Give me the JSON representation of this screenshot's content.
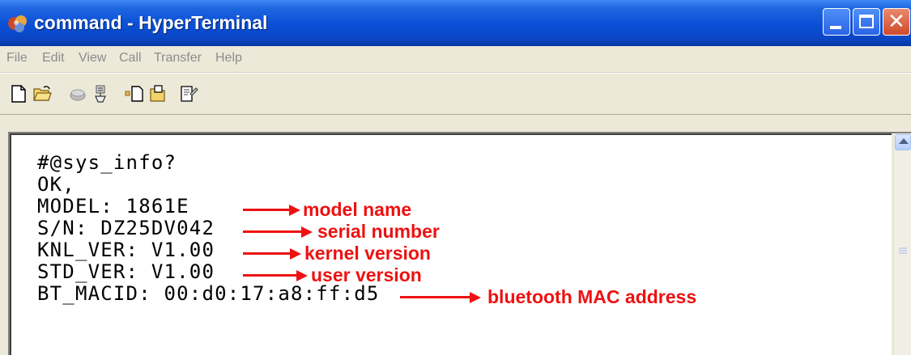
{
  "window": {
    "title": "command - HyperTerminal",
    "controls": {
      "minimize_icon": "minimize-icon",
      "maximize_icon": "maximize-icon",
      "close_label": "✕"
    }
  },
  "menubar": {
    "items": [
      "File",
      "Edit",
      "View",
      "Call",
      "Transfer",
      "Help"
    ]
  },
  "toolbar": {
    "icons": [
      "new-document-icon",
      "open-folder-icon",
      "dial-icon",
      "disconnect-icon",
      "send-icon",
      "receive-icon",
      "properties-icon"
    ]
  },
  "terminal": {
    "lines": [
      "#@sys_info?",
      "OK,",
      "MODEL: 1861E",
      "S/N: DZ25DV042",
      "KNL_VER: V1.00",
      "STD_VER: V1.00",
      "BT_MACID: 00:d0:17:a8:ff:d5"
    ]
  },
  "annotations": {
    "color": "#ee1111",
    "items": [
      {
        "label": "model name"
      },
      {
        "label": "serial number"
      },
      {
        "label": "kernel version"
      },
      {
        "label": "user version"
      },
      {
        "label": "bluetooth MAC address"
      }
    ]
  }
}
